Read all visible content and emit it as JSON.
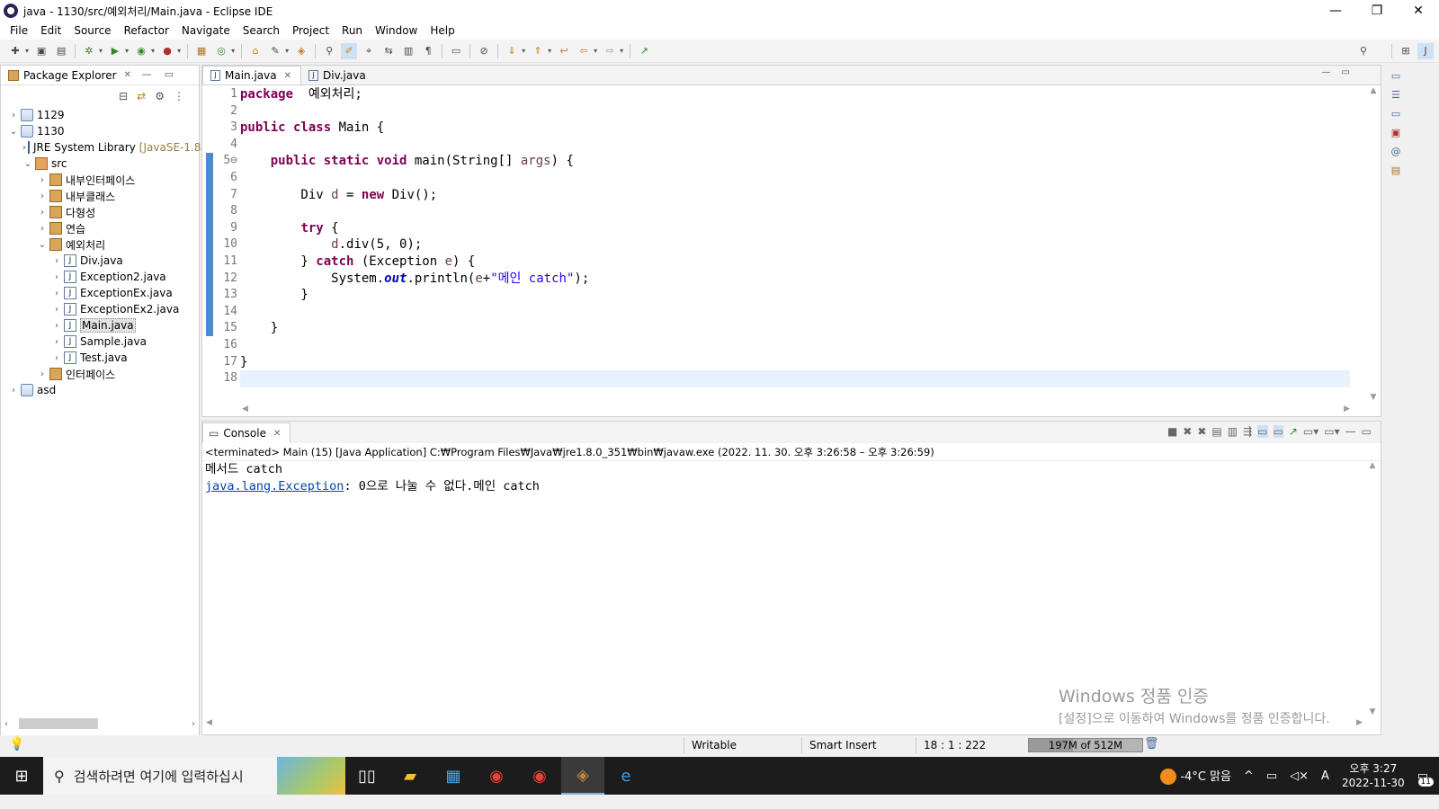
{
  "window": {
    "title": "java - 1130/src/예외처리/Main.java - Eclipse IDE",
    "min": "—",
    "max": "❐",
    "close": "✕"
  },
  "menu": [
    "File",
    "Edit",
    "Source",
    "Refactor",
    "Navigate",
    "Search",
    "Project",
    "Run",
    "Window",
    "Help"
  ],
  "explorer": {
    "tab": "Package Explorer",
    "tree": [
      {
        "label": "1129",
        "chev": "›",
        "icon": "project",
        "indent": 0
      },
      {
        "label": "1130",
        "chev": "⌄",
        "icon": "project",
        "indent": 0
      },
      {
        "label": "JRE System Library",
        "extra": "[JavaSE-1.8]",
        "chev": "›",
        "icon": "jre",
        "indent": 1
      },
      {
        "label": "src",
        "chev": "⌄",
        "icon": "src",
        "indent": 1
      },
      {
        "label": "내부인터페이스",
        "chev": "›",
        "icon": "pkg",
        "indent": 2
      },
      {
        "label": "내부클래스",
        "chev": "›",
        "icon": "pkg",
        "indent": 2
      },
      {
        "label": "다형성",
        "chev": "›",
        "icon": "pkg",
        "indent": 2
      },
      {
        "label": "연습",
        "chev": "›",
        "icon": "pkg",
        "indent": 2
      },
      {
        "label": "예외처리",
        "chev": "⌄",
        "icon": "pkg",
        "indent": 2
      },
      {
        "label": "Div.java",
        "chev": "›",
        "icon": "java",
        "indent": 3
      },
      {
        "label": "Exception2.java",
        "chev": "›",
        "icon": "java",
        "indent": 3
      },
      {
        "label": "ExceptionEx.java",
        "chev": "›",
        "icon": "java",
        "indent": 3
      },
      {
        "label": "ExceptionEx2.java",
        "chev": "›",
        "icon": "java",
        "indent": 3
      },
      {
        "label": "Main.java",
        "chev": "›",
        "icon": "java",
        "indent": 3,
        "selected": true
      },
      {
        "label": "Sample.java",
        "chev": "›",
        "icon": "java",
        "indent": 3
      },
      {
        "label": "Test.java",
        "chev": "›",
        "icon": "java",
        "indent": 3
      },
      {
        "label": "인터페이스",
        "chev": "›",
        "icon": "pkg",
        "indent": 2
      },
      {
        "label": "asd",
        "chev": "›",
        "icon": "project",
        "indent": 0
      }
    ]
  },
  "editor": {
    "tabs": [
      {
        "label": "Main.java",
        "active": true
      },
      {
        "label": "Div.java",
        "active": false
      }
    ],
    "line_numbers": [
      "1",
      "2",
      "3",
      "4",
      "5⊖",
      "6",
      "7",
      "8",
      "9",
      "10",
      "11",
      "12",
      "13",
      "14",
      "15",
      "16",
      "17",
      "18"
    ],
    "code_lines": [
      [
        [
          "kw",
          "package"
        ],
        [
          "",
          "  예외처리;"
        ]
      ],
      [],
      [
        [
          "kw",
          "public class"
        ],
        [
          "",
          " Main {"
        ]
      ],
      [],
      [
        [
          "",
          "    "
        ],
        [
          "kw",
          "public static void"
        ],
        [
          "",
          " main(String[] "
        ],
        [
          "var",
          "args"
        ],
        [
          "",
          ") {"
        ]
      ],
      [],
      [
        [
          "",
          "        Div "
        ],
        [
          "var",
          "d"
        ],
        [
          "",
          " = "
        ],
        [
          "kw",
          "new"
        ],
        [
          "",
          " Div();"
        ]
      ],
      [],
      [
        [
          "",
          "        "
        ],
        [
          "kw",
          "try"
        ],
        [
          "",
          " {"
        ]
      ],
      [
        [
          "",
          "            "
        ],
        [
          "var",
          "d"
        ],
        [
          "",
          ".div(5, 0);"
        ]
      ],
      [
        [
          "",
          "        } "
        ],
        [
          "kw",
          "catch"
        ],
        [
          "",
          " (Exception "
        ],
        [
          "var",
          "e"
        ],
        [
          "",
          ") {"
        ]
      ],
      [
        [
          "",
          "            System."
        ],
        [
          "fld",
          "out"
        ],
        [
          "",
          ".println("
        ],
        [
          "var",
          "e"
        ],
        [
          "",
          "+"
        ],
        [
          "str",
          "\"메인 catch\""
        ],
        [
          "",
          ");"
        ]
      ],
      [
        [
          "",
          "        }"
        ]
      ],
      [],
      [
        [
          "",
          "    }"
        ]
      ],
      [],
      [
        [
          "",
          "}"
        ]
      ],
      []
    ],
    "current_line": 18
  },
  "console": {
    "tab": "Console",
    "terminated": "<terminated> Main (15) [Java Application] C:₩Program Files₩Java₩jre1.8.0_351₩bin₩javaw.exe  (2022. 11. 30. 오후 3:26:58 – 오후 3:26:59)",
    "line1": "메서드 catch",
    "exception_link": "java.lang.Exception",
    "exception_msg": ": 0으로 나눌 수 없다.메인 catch"
  },
  "watermark": {
    "line1": "Windows 정품 인증",
    "line2": "[설정]으로 이동하여 Windows를 정품 인증합니다."
  },
  "status": {
    "writable": "Writable",
    "insert": "Smart Insert",
    "position": "18 : 1 : 222",
    "heap": "197M of 512M",
    "heap_fraction": 0.385
  },
  "taskbar": {
    "search_placeholder": "검색하려면 여기에 입력하십시",
    "weather": "-4°C  맑음",
    "ime": "A",
    "time": "오후 3:27",
    "date": "2022-11-30",
    "notifications": "11"
  },
  "colors": {
    "keyword": "#7f0055",
    "string": "#2a00ff",
    "field": "#0000c0",
    "variable": "#6a3e3e",
    "current_line": "#e8f2fe"
  }
}
